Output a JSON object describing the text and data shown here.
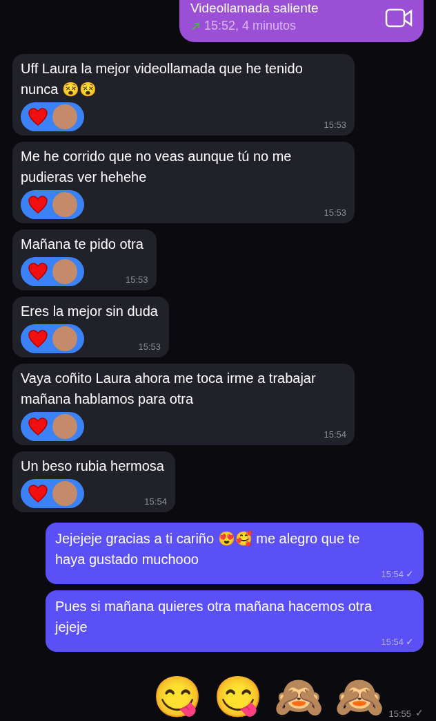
{
  "call": {
    "title": "Videollamada saliente",
    "detail": "15:52, 4 minutos"
  },
  "messages": [
    {
      "kind": "incoming",
      "text": "Uff Laura la mejor videollamada que he tenido nunca 😵😵",
      "time": "15:53"
    },
    {
      "kind": "incoming",
      "text": "Me he corrido que no veas aunque tú no me pudieras ver hehehe",
      "time": "15:53"
    },
    {
      "kind": "incoming",
      "text": "Mañana te pido otra",
      "time": "15:53"
    },
    {
      "kind": "incoming",
      "text": "Eres la mejor sin duda",
      "time": "15:53"
    },
    {
      "kind": "incoming",
      "text": "Vaya coñito Laura ahora me toca irme a trabajar mañana hablamos para otra",
      "time": "15:54"
    },
    {
      "kind": "incoming",
      "text": "Un beso rubia hermosa",
      "time": "15:54"
    },
    {
      "kind": "outgoing",
      "text": "Jejejeje gracias a ti cariño 😍🥰 me alegro que te haya gustado muchooo",
      "time": "15:54",
      "status": "✓"
    },
    {
      "kind": "outgoing",
      "text": "Pues si mañana quieres otra mañana hacemos otra jejeje",
      "time": "15:54",
      "status": "✓"
    },
    {
      "kind": "emoji",
      "text": "😋 😋 🙈 🙈",
      "time": "15:55",
      "status": "✓"
    }
  ]
}
